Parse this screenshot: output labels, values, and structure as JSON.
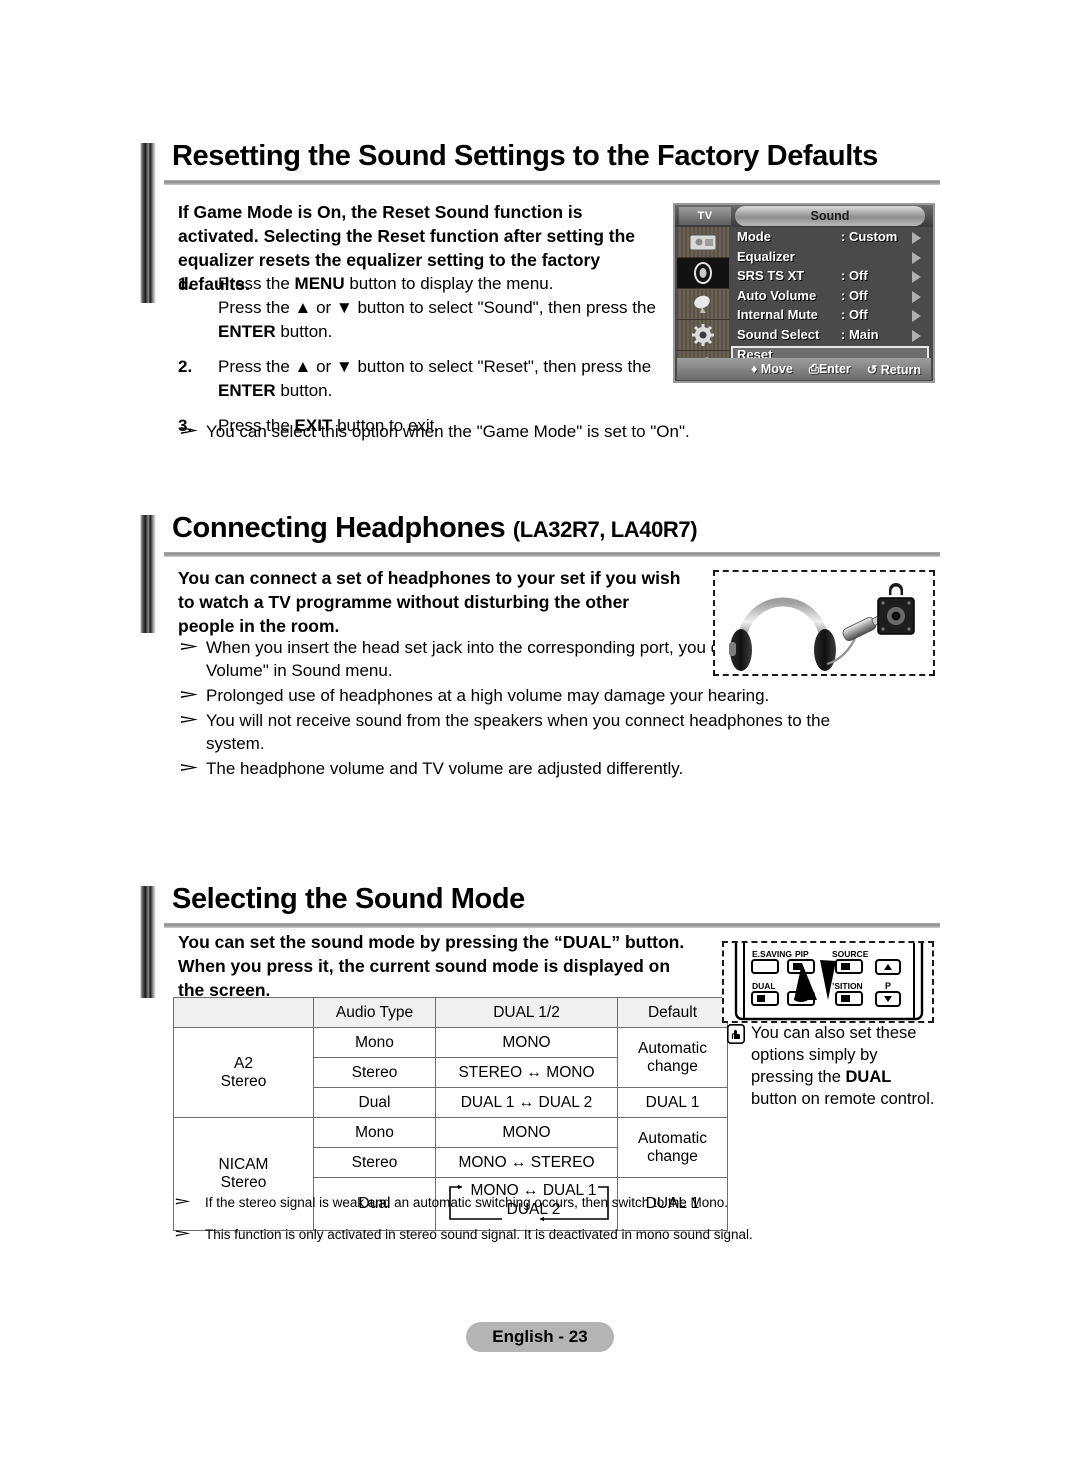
{
  "page": {
    "footer_label": "English - 23"
  },
  "section1": {
    "heading": "Resetting the Sound Settings to the Factory Defaults",
    "intro": "If Game Mode is On, the Reset Sound function is activated. Selecting the Reset function after setting the equalizer resets the equalizer setting to the factory defaults.",
    "steps": [
      {
        "num": "1.",
        "line1_a": "Press the ",
        "line1_b": "MENU",
        "line1_c": " button to display the menu.",
        "line2_a": "Press the ▲ or ▼  button to select \"Sound\", then press the",
        "line3_b": "ENTER",
        "line3_c": " button."
      },
      {
        "num": "2.",
        "line1_a": "Press the ▲ or ▼ button to select \"Reset\", then press the",
        "line3_b": "ENTER",
        "line3_c": " button."
      },
      {
        "num": "3.",
        "line1_a": "Press the ",
        "line1_b": "EXIT",
        "line1_c": " button to exit."
      }
    ],
    "note": "You can select this option when the \"Game Mode\" is set to \"On\"."
  },
  "osd": {
    "tv_label": "TV",
    "title": "Sound",
    "rows": [
      {
        "label": "Mode",
        "value": ": Custom",
        "chevron": true
      },
      {
        "label": "Equalizer",
        "value": "",
        "chevron": true
      },
      {
        "label": "SRS TS XT",
        "value": ": Off",
        "chevron": true
      },
      {
        "label": "Auto Volume",
        "value": ": Off",
        "chevron": true
      },
      {
        "label": "Internal Mute",
        "value": ": Off",
        "chevron": true
      },
      {
        "label": "Sound Select",
        "value": ": Main",
        "chevron": true
      },
      {
        "label": "Reset",
        "value": "",
        "chevron": false,
        "highlight": true
      }
    ],
    "footer": {
      "move": "♦ Move",
      "enter": "⎙Enter",
      "return": "↺ Return"
    }
  },
  "section2": {
    "heading_main": "Connecting Headphones",
    "heading_models": "(LA32R7, LA40R7)",
    "intro": "You can connect a set of headphones to your set if you wish to watch a TV programme without disturbing the other people in the room.",
    "notes": [
      "When you insert the head set jack into the corresponding port, you can operate only \"Auto Volume\" in Sound menu.",
      "Prolonged use of headphones at a high volume may damage your hearing.",
      "You will not receive sound from the speakers when you connect headphones to the system.",
      "The headphone volume and TV volume are adjusted differently."
    ]
  },
  "section3": {
    "heading": "Selecting the Sound Mode",
    "intro": "You can set the sound mode by pressing the “DUAL” button. When you press it, the current sound mode is displayed on the screen.",
    "table": {
      "headers": [
        "",
        "Audio Type",
        "DUAL 1/2",
        "Default"
      ],
      "groups": [
        {
          "name": "A2\nStereo",
          "name_line1": "A2",
          "name_line2": "Stereo",
          "rows": [
            {
              "audio_type": "Mono",
              "dual": "MONO",
              "default": "Automatic change",
              "default_rowspan": 2
            },
            {
              "audio_type": "Stereo",
              "dual": "STEREO ↔ MONO"
            },
            {
              "audio_type": "Dual",
              "dual": "DUAL 1 ↔ DUAL 2",
              "default": "DUAL 1"
            }
          ]
        },
        {
          "name_line1": "NICAM",
          "name_line2": "Stereo",
          "rows": [
            {
              "audio_type": "Mono",
              "dual": "MONO",
              "default": "Automatic change",
              "default_rowspan": 2
            },
            {
              "audio_type": "Stereo",
              "dual": "MONO ↔ STEREO"
            },
            {
              "audio_type": "Dual",
              "dual_line1": "MONO ↔ DUAL 1",
              "dual_line2": "DUAL 2",
              "default": "DUAL 1"
            }
          ]
        }
      ]
    },
    "remote": {
      "keys": [
        {
          "label": "E.SAVING"
        },
        {
          "label": "PIP"
        },
        {
          "label": "SOURCE"
        },
        {
          "label": "DUAL"
        },
        {
          "label": "’SITION"
        },
        {
          "label": "P"
        }
      ]
    },
    "hand_note": {
      "line1": "You can also set these",
      "line2": "options simply by",
      "line3_a": "pressing the ",
      "line3_b": "DUAL",
      "line4": "button on remote control."
    },
    "footnotes": [
      "If the stereo signal is weak and an automatic switching occurs, then switch to the Mono.",
      "This function is only activated in stereo sound signal. It is deactivated in mono sound signal."
    ]
  }
}
